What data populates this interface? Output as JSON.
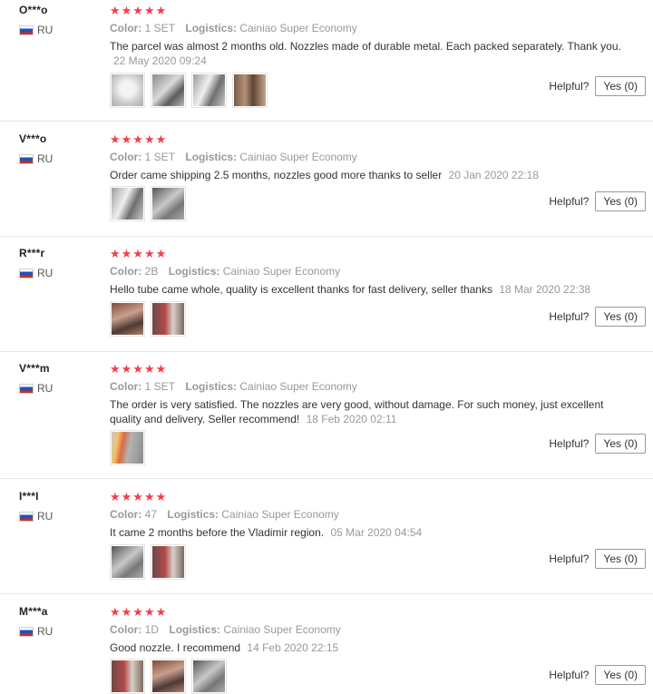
{
  "helpful_label": "Helpful?",
  "color_key": "Color:",
  "logistics_key": "Logistics:",
  "stars": "★★★★★",
  "reviews": [
    {
      "user": "O***o",
      "country": "RU",
      "color": "1 SET",
      "logistics": "Cainiao Super Economy",
      "text": "The parcel was almost 2 months old. Nozzles made of durable metal. Each packed separately. Thank you.",
      "date": "22 May 2020 09:24",
      "yes": "Yes (0)"
    },
    {
      "user": "V***o",
      "country": "RU",
      "color": "1 SET",
      "logistics": "Cainiao Super Economy",
      "text": "Order came shipping 2.5 months, nozzles good more thanks to seller",
      "date": "20 Jan 2020 22:18",
      "yes": "Yes (0)"
    },
    {
      "user": "R***r",
      "country": "RU",
      "color": "2B",
      "logistics": "Cainiao Super Economy",
      "text": "Hello tube came whole, quality is excellent thanks for fast delivery, seller thanks",
      "date": "18 Mar 2020 22:38",
      "yes": "Yes (0)"
    },
    {
      "user": "V***m",
      "country": "RU",
      "color": "1 SET",
      "logistics": "Cainiao Super Economy",
      "text": "The order is very satisfied. The nozzles are very good, without damage. For such money, just excellent quality and delivery. Seller recommend!",
      "date": "18 Feb 2020 02:11",
      "yes": "Yes (0)"
    },
    {
      "user": "I***I",
      "country": "RU",
      "color": "47",
      "logistics": "Cainiao Super Economy",
      "text": "It came 2 months before the Vladimir region.",
      "date": "05 Mar 2020 04:54",
      "yes": "Yes (0)"
    },
    {
      "user": "M***a",
      "country": "RU",
      "color": "1D",
      "logistics": "Cainiao Super Economy",
      "text": "Good nozzle. I recommend",
      "date": "14 Feb 2020 22:15",
      "yes": "Yes (0)"
    }
  ]
}
